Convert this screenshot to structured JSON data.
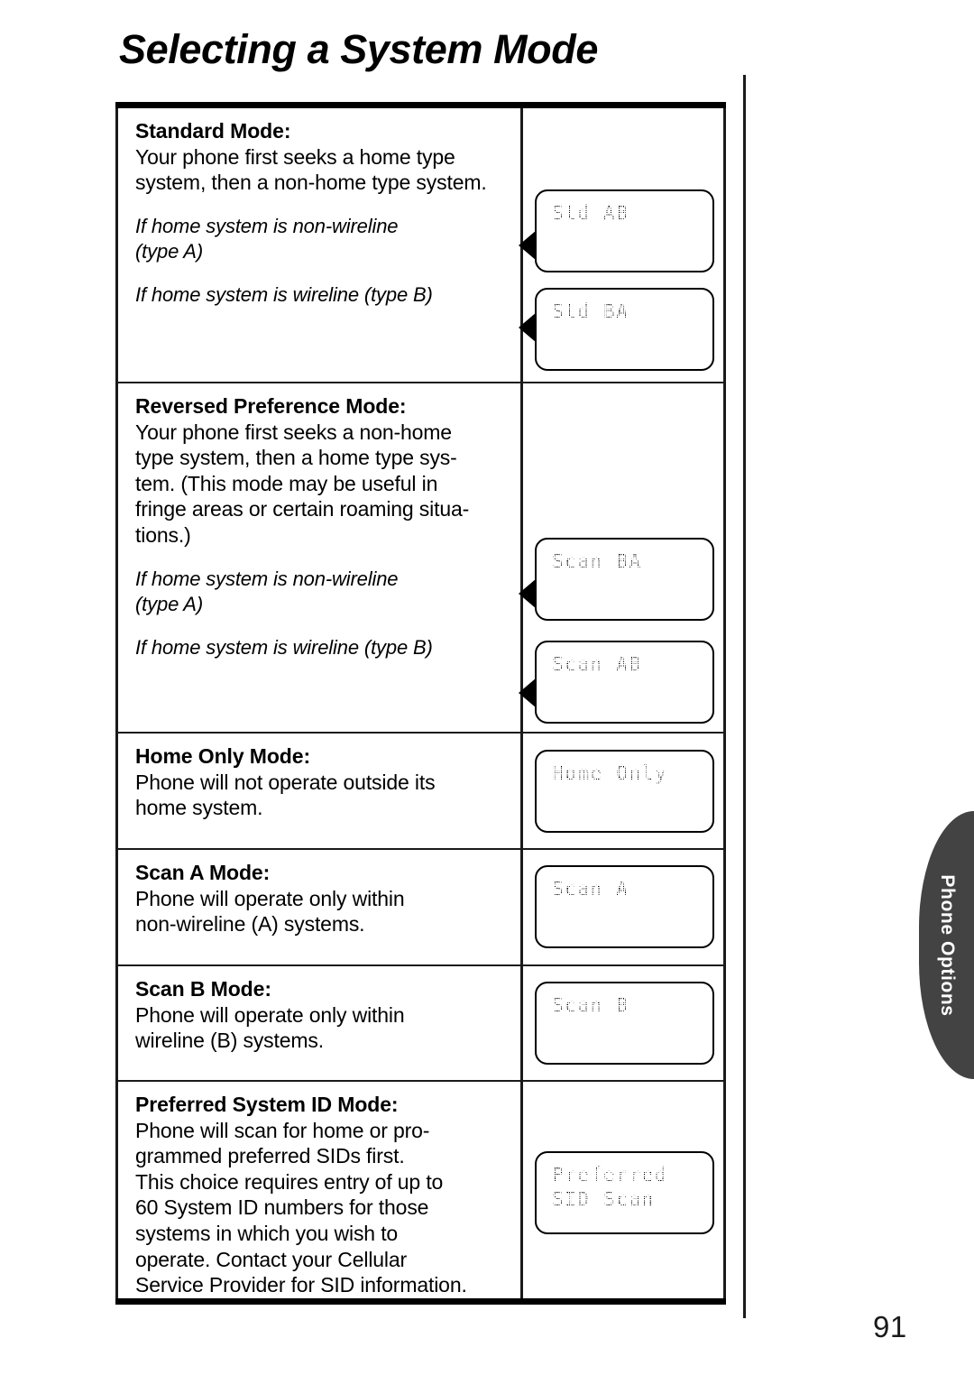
{
  "page": {
    "title": "Selecting a System Mode",
    "folio": "91"
  },
  "side_tab": {
    "label": "Phone Options"
  },
  "table": {
    "rows": [
      {
        "heading": "Standard Mode:",
        "body": "Your phone first seeks a home type system, then a non-home type system.",
        "conditions": [
          "If home system is non-wireline (type A)",
          "If home system is wireline (type B)"
        ],
        "displays": [
          "Std AB",
          "Std BA"
        ]
      },
      {
        "heading": "Reversed Preference Mode:",
        "body": "Your phone first seeks a non-home type system, then a home type system. (This mode may be useful in fringe areas or certain roaming situations.)",
        "conditions": [
          "If home system is non-wireline (type A)",
          "If home system is wireline (type B)"
        ],
        "displays": [
          "Scan BA",
          "Scan AB"
        ]
      },
      {
        "heading": "Home Only Mode:",
        "body": "Phone will not operate outside its home system.",
        "conditions": [],
        "displays": [
          "Home Only"
        ]
      },
      {
        "heading": "Scan A Mode:",
        "body": "Phone will operate only within non-wireline (A) systems.",
        "conditions": [],
        "displays": [
          "Scan A"
        ]
      },
      {
        "heading": "Scan B Mode:",
        "body": "Phone will operate only within wireline (B) systems.",
        "conditions": [],
        "displays": [
          "Scan B"
        ]
      },
      {
        "heading": "Preferred System ID Mode:",
        "body": "Phone will scan for home or programmed preferred SIDs first. This choice requires entry of up to 60 System ID numbers for those systems in which you wish to operate. Contact your Cellular Service Provider for SID information.",
        "conditions": [],
        "displays": [
          "Preferred\nSID Scan"
        ]
      }
    ]
  },
  "lines": {
    "r0_body_1": "Your phone first seeks a home type",
    "r0_body_2": "system, then a non-home type system.",
    "r0_cond_1a": "If home system is non-wireline",
    "r0_cond_1b": "(type A)",
    "r0_cond_2": "If home system is wireline (type B)",
    "r1_body_1": "Your phone first seeks a non-home",
    "r1_body_2": "type system, then a home type sys-",
    "r1_body_3": "tem. (This mode may be useful in",
    "r1_body_4": "fringe areas or certain roaming situa-",
    "r1_body_5": "tions.)",
    "r1_cond_1a": "If home system is non-wireline",
    "r1_cond_1b": "(type A)",
    "r1_cond_2": "If home system is wireline (type B)",
    "r2_body_1": "Phone will not operate outside its",
    "r2_body_2": "home system.",
    "r3_body_1": "Phone will operate only within",
    "r3_body_2": "non-wireline (A) systems.",
    "r4_body_1": "Phone will operate only within",
    "r4_body_2": "wireline (B) systems.",
    "r5_body_1": "Phone will scan for home or pro-",
    "r5_body_2": "grammed preferred SIDs first.",
    "r5_body_3": "This choice requires entry of up to",
    "r5_body_4": "60 System ID numbers for those",
    "r5_body_5": "systems in which you wish to",
    "r5_body_6": "operate. Contact your Cellular",
    "r5_body_7": "Service Provider for SID information.",
    "lcd_std_ab": "Std AB",
    "lcd_std_ba": "Std BA",
    "lcd_scan_ba": "Scan BA",
    "lcd_scan_ab": "Scan AB",
    "lcd_home_only": "Home Only",
    "lcd_scan_a": "Scan A",
    "lcd_scan_b": "Scan B",
    "lcd_pref_1": "Preferred",
    "lcd_pref_2": "SID Scan"
  }
}
